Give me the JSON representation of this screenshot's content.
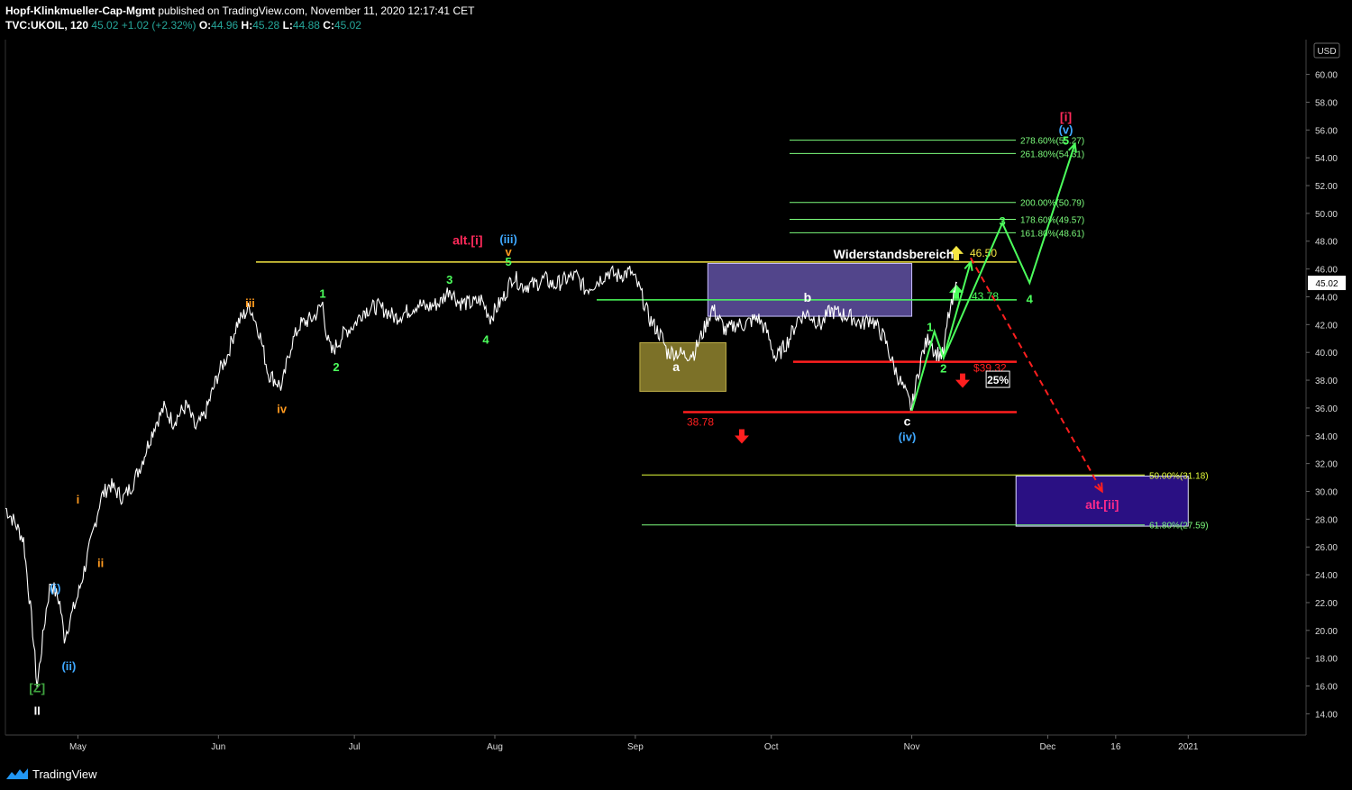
{
  "header": {
    "author": "Hopf-Klinkmueller-Cap-Mgmt",
    "published": " published on TradingView.com, November 11, 2020 12:17:41 CET",
    "symbol": "TVC:UKOIL, 120",
    "last": "45.02",
    "change": "+1.02 (+2.32%)",
    "o_label": "O:",
    "o": "44.96",
    "h_label": "H:",
    "h": "45.28",
    "l_label": "L:",
    "l": "44.88",
    "c_label": "C:",
    "c": "45.02"
  },
  "footer": {
    "brand": "TradingView"
  },
  "chart_data": {
    "type": "line",
    "title": "",
    "currency": "USD",
    "last_price_label": "45.02",
    "ylim": [
      12.6,
      62.5
    ],
    "y_ticks": [
      14,
      16,
      18,
      20,
      22,
      24,
      26,
      28,
      30,
      32,
      34,
      36,
      38,
      40,
      42,
      44,
      46,
      48,
      50,
      52,
      54,
      56,
      58,
      60
    ],
    "x_ticks": [
      {
        "label": "May",
        "x": "2020-05-01"
      },
      {
        "label": "Jun",
        "x": "2020-06-01"
      },
      {
        "label": "Jul",
        "x": "2020-07-01"
      },
      {
        "label": "Aug",
        "x": "2020-08-01"
      },
      {
        "label": "Sep",
        "x": "2020-09-01"
      },
      {
        "label": "Oct",
        "x": "2020-10-01"
      },
      {
        "label": "Nov",
        "x": "2020-11-01"
      },
      {
        "label": "Dec",
        "x": "2020-12-01"
      },
      {
        "label": "16",
        "x": "2020-12-16"
      },
      {
        "label": "2021",
        "x": "2021-01-01"
      }
    ],
    "xlim": [
      "2020-04-15",
      "2021-01-27"
    ],
    "series": [
      {
        "color": "#ffffff",
        "points": [
          [
            "2020-04-15",
            28.8
          ],
          [
            "2020-04-17",
            27.8
          ],
          [
            "2020-04-19",
            26.5
          ],
          [
            "2020-04-21",
            20.0
          ],
          [
            "2020-04-22",
            16.0
          ],
          [
            "2020-04-24",
            21.5
          ],
          [
            "2020-04-25",
            23.5
          ],
          [
            "2020-04-27",
            22.0
          ],
          [
            "2020-04-28",
            19.5
          ],
          [
            "2020-04-29",
            20.5
          ],
          [
            "2020-05-01",
            22.5
          ],
          [
            "2020-05-04",
            26.5
          ],
          [
            "2020-05-06",
            29.5
          ],
          [
            "2020-05-08",
            30.5
          ],
          [
            "2020-05-11",
            29.5
          ],
          [
            "2020-05-13",
            30.5
          ],
          [
            "2020-05-15",
            32.0
          ],
          [
            "2020-05-18",
            34.8
          ],
          [
            "2020-05-20",
            36.0
          ],
          [
            "2020-05-22",
            35.0
          ],
          [
            "2020-05-25",
            36.2
          ],
          [
            "2020-05-27",
            34.5
          ],
          [
            "2020-05-29",
            35.5
          ],
          [
            "2020-06-01",
            38.5
          ],
          [
            "2020-06-03",
            39.8
          ],
          [
            "2020-06-05",
            42.0
          ],
          [
            "2020-06-08",
            43.3
          ],
          [
            "2020-06-10",
            41.5
          ],
          [
            "2020-06-12",
            38.5
          ],
          [
            "2020-06-15",
            37.5
          ],
          [
            "2020-06-17",
            40.5
          ],
          [
            "2020-06-19",
            42.0
          ],
          [
            "2020-06-22",
            42.5
          ],
          [
            "2020-06-24",
            43.5
          ],
          [
            "2020-06-25",
            41.0
          ],
          [
            "2020-06-26",
            40.0
          ],
          [
            "2020-06-29",
            41.5
          ],
          [
            "2020-07-01",
            42.0
          ],
          [
            "2020-07-03",
            43.0
          ],
          [
            "2020-07-06",
            43.3
          ],
          [
            "2020-07-08",
            43.0
          ],
          [
            "2020-07-10",
            42.5
          ],
          [
            "2020-07-13",
            43.0
          ],
          [
            "2020-07-15",
            43.5
          ],
          [
            "2020-07-17",
            43.2
          ],
          [
            "2020-07-20",
            43.6
          ],
          [
            "2020-07-22",
            44.6
          ],
          [
            "2020-07-24",
            43.6
          ],
          [
            "2020-07-27",
            43.5
          ],
          [
            "2020-07-29",
            43.8
          ],
          [
            "2020-07-31",
            42.5
          ],
          [
            "2020-08-03",
            44.0
          ],
          [
            "2020-08-05",
            45.5
          ],
          [
            "2020-08-07",
            44.8
          ],
          [
            "2020-08-10",
            44.9
          ],
          [
            "2020-08-12",
            45.3
          ],
          [
            "2020-08-14",
            44.8
          ],
          [
            "2020-08-17",
            45.3
          ],
          [
            "2020-08-19",
            45.5
          ],
          [
            "2020-08-21",
            44.5
          ],
          [
            "2020-08-24",
            45.2
          ],
          [
            "2020-08-26",
            45.8
          ],
          [
            "2020-08-28",
            45.5
          ],
          [
            "2020-08-31",
            45.8
          ],
          [
            "2020-09-02",
            44.5
          ],
          [
            "2020-09-04",
            42.5
          ],
          [
            "2020-09-07",
            41.0
          ],
          [
            "2020-09-08",
            40.0
          ],
          [
            "2020-09-10",
            40.0
          ],
          [
            "2020-09-12",
            39.8
          ],
          [
            "2020-09-14",
            40.0
          ],
          [
            "2020-09-16",
            41.5
          ],
          [
            "2020-09-18",
            43.2
          ],
          [
            "2020-09-21",
            41.5
          ],
          [
            "2020-09-23",
            42.0
          ],
          [
            "2020-09-25",
            42.0
          ],
          [
            "2020-09-28",
            42.5
          ],
          [
            "2020-09-30",
            41.5
          ],
          [
            "2020-10-02",
            39.5
          ],
          [
            "2020-10-05",
            41.0
          ],
          [
            "2020-10-07",
            42.5
          ],
          [
            "2020-10-09",
            42.8
          ],
          [
            "2020-10-12",
            42.0
          ],
          [
            "2020-10-14",
            43.0
          ],
          [
            "2020-10-16",
            42.8
          ],
          [
            "2020-10-19",
            42.5
          ],
          [
            "2020-10-21",
            42.0
          ],
          [
            "2020-10-23",
            42.5
          ],
          [
            "2020-10-26",
            41.0
          ],
          [
            "2020-10-28",
            39.0
          ],
          [
            "2020-10-30",
            37.5
          ],
          [
            "2020-11-01",
            36.0
          ],
          [
            "2020-11-02",
            37.8
          ],
          [
            "2020-11-03",
            39.5
          ],
          [
            "2020-11-04",
            40.5
          ],
          [
            "2020-11-05",
            41.2
          ],
          [
            "2020-11-06",
            40.0
          ],
          [
            "2020-11-08",
            39.8
          ],
          [
            "2020-11-09",
            42.5
          ],
          [
            "2020-11-10",
            43.5
          ],
          [
            "2020-11-11",
            45.0
          ]
        ]
      }
    ],
    "horizontal_levels": [
      {
        "y": 46.5,
        "color": "#f5e642",
        "label": "46.50",
        "label_color": "#f5e642",
        "arrow": "up",
        "arrow_color": "#f5e642"
      },
      {
        "y": 43.78,
        "color": "#4cff5c",
        "label": "43.78",
        "label_color": "#4cff5c",
        "arrow": "up",
        "arrow_color": "#4cff5c"
      },
      {
        "y": 39.32,
        "color": "#ff1f1f",
        "label": "$39.32",
        "label_color": "#ff1f1f",
        "arrow": "down",
        "arrow_color": "#ff1f1f"
      },
      {
        "y": 35.7,
        "color": "#ff1f1f",
        "label": "38.78",
        "label_color": "#ff1f1f",
        "arrow": "down",
        "arrow_color": "#ff1f1f"
      }
    ],
    "fib_levels": [
      {
        "label": "278.60%(55.27)",
        "y": 55.27,
        "color": "#7CFC7C"
      },
      {
        "label": "261.80%(54.31)",
        "y": 54.31,
        "color": "#7CFC7C"
      },
      {
        "label": "200.00%(50.79)",
        "y": 50.79,
        "color": "#7CFC7C"
      },
      {
        "label": "178.60%(49.57)",
        "y": 49.57,
        "color": "#7CFC7C"
      },
      {
        "label": "161.80%(48.61)",
        "y": 48.61,
        "color": "#7CFC7C"
      },
      {
        "label": "50.00%(31.18)",
        "y": 31.18,
        "color": "#e6ff3a"
      },
      {
        "label": "61.80%(27.59)",
        "y": 27.59,
        "color": "#7CFC7C"
      }
    ],
    "zones": [
      {
        "name": "a-zone",
        "x0": "2020-09-02",
        "x1": "2020-09-21",
        "y0": 37.2,
        "y1": 40.7,
        "fill": "#8a7d2c",
        "stroke": "#c2b24a"
      },
      {
        "name": "b-zone",
        "x0": "2020-09-17",
        "x1": "2020-11-01",
        "y0": 42.6,
        "y1": 46.4,
        "fill": "#5b4d9a",
        "stroke": "#c9c0ff"
      },
      {
        "name": "alt-ii-zone",
        "x0": "2020-11-24",
        "x1": "2021-01-01",
        "y0": 27.5,
        "y1": 31.1,
        "fill": "#2f1291",
        "stroke": "#e0e0ff"
      }
    ],
    "annotations": [
      {
        "text": "Widerstandsbereich",
        "x": "2020-10-28",
        "y": 47.0,
        "color": "#ffffff",
        "size": 14
      },
      {
        "text": "[Z]",
        "x": "2020-04-22",
        "y": 15.8,
        "color": "#3fa33f",
        "size": 14
      },
      {
        "text": "II",
        "x": "2020-04-22",
        "y": 14.2,
        "color": "#ffffff",
        "size": 13
      },
      {
        "text": "(i)",
        "x": "2020-04-26",
        "y": 23.0,
        "color": "#3fa8ff",
        "size": 13
      },
      {
        "text": "(ii)",
        "x": "2020-04-29",
        "y": 17.4,
        "color": "#3fa8ff",
        "size": 13
      },
      {
        "text": "i",
        "x": "2020-05-01",
        "y": 29.4,
        "color": "#ff9a1f",
        "size": 13
      },
      {
        "text": "ii",
        "x": "2020-05-06",
        "y": 24.8,
        "color": "#ff9a1f",
        "size": 13
      },
      {
        "text": "iii",
        "x": "2020-06-08",
        "y": 43.5,
        "color": "#ff9a1f",
        "size": 13
      },
      {
        "text": "iv",
        "x": "2020-06-15",
        "y": 35.9,
        "color": "#ff9a1f",
        "size": 13
      },
      {
        "text": "1",
        "x": "2020-06-24",
        "y": 44.2,
        "color": "#4cff5c",
        "size": 13
      },
      {
        "text": "2",
        "x": "2020-06-27",
        "y": 38.9,
        "color": "#4cff5c",
        "size": 13
      },
      {
        "text": "3",
        "x": "2020-07-22",
        "y": 45.2,
        "color": "#4cff5c",
        "size": 13
      },
      {
        "text": "4",
        "x": "2020-07-30",
        "y": 40.9,
        "color": "#4cff5c",
        "size": 13
      },
      {
        "text": "alt.[i]",
        "x": "2020-07-26",
        "y": 48.0,
        "color": "#ff2a5a",
        "size": 14
      },
      {
        "text": "(iii)",
        "x": "2020-08-04",
        "y": 48.1,
        "color": "#3fa8ff",
        "size": 13
      },
      {
        "text": "v",
        "x": "2020-08-04",
        "y": 47.2,
        "color": "#ff9a1f",
        "size": 13
      },
      {
        "text": "5",
        "x": "2020-08-04",
        "y": 46.5,
        "color": "#4cff5c",
        "size": 13
      },
      {
        "text": "a",
        "x": "2020-09-10",
        "y": 38.9,
        "color": "#ffffff",
        "size": 14
      },
      {
        "text": "b",
        "x": "2020-10-09",
        "y": 43.9,
        "color": "#ffffff",
        "size": 14
      },
      {
        "text": "c",
        "x": "2020-10-31",
        "y": 35.0,
        "color": "#ffffff",
        "size": 14
      },
      {
        "text": "(iv)",
        "x": "2020-10-31",
        "y": 33.9,
        "color": "#3fa8ff",
        "size": 13
      },
      {
        "text": "1",
        "x": "2020-11-05",
        "y": 41.8,
        "color": "#4cff5c",
        "size": 13
      },
      {
        "text": "2",
        "x": "2020-11-08",
        "y": 38.8,
        "color": "#4cff5c",
        "size": 13
      },
      {
        "text": "3",
        "x": "2020-11-21",
        "y": 49.4,
        "color": "#4cff5c",
        "size": 13
      },
      {
        "text": "4",
        "x": "2020-11-27",
        "y": 43.8,
        "color": "#4cff5c",
        "size": 13
      },
      {
        "text": "5",
        "x": "2020-12-05",
        "y": 55.2,
        "color": "#4cff5c",
        "size": 13
      },
      {
        "text": "(v)",
        "x": "2020-12-05",
        "y": 56.0,
        "color": "#3fa8ff",
        "size": 13
      },
      {
        "text": "[i]",
        "x": "2020-12-05",
        "y": 56.9,
        "color": "#ff2a5a",
        "size": 14
      },
      {
        "text": "25%",
        "x": "2020-11-20",
        "y": 38.0,
        "color": "#ffffff",
        "size": 12,
        "boxed": true
      },
      {
        "text": "alt.[ii]",
        "x": "2020-12-13",
        "y": 29.0,
        "color": "#ff2a8a",
        "size": 14
      }
    ],
    "projections": [
      {
        "color": "#4cff5c",
        "dashed": false,
        "points": [
          [
            "2020-11-01",
            35.8
          ],
          [
            "2020-11-06",
            41.5
          ],
          [
            "2020-11-08",
            39.6
          ],
          [
            "2020-11-14",
            46.5
          ]
        ]
      },
      {
        "color": "#4cff5c",
        "dashed": false,
        "points": [
          [
            "2020-11-08",
            39.6
          ],
          [
            "2020-11-21",
            49.3
          ],
          [
            "2020-11-27",
            45.0
          ],
          [
            "2020-12-07",
            55.0
          ]
        ]
      },
      {
        "color": "#ff1f1f",
        "dashed": true,
        "points": [
          [
            "2020-11-14",
            46.8
          ],
          [
            "2020-12-01",
            37.0
          ],
          [
            "2020-12-13",
            30.0
          ]
        ]
      }
    ]
  }
}
